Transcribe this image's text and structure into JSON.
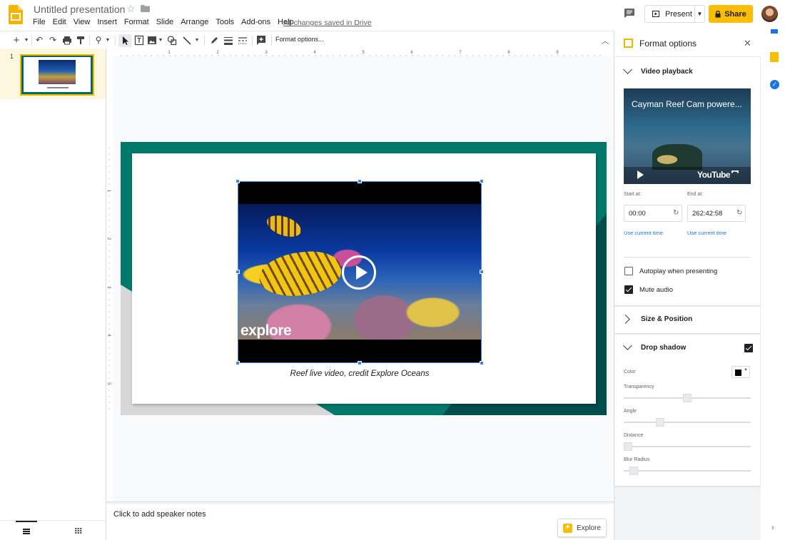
{
  "header": {
    "doc_title": "Untitled presentation",
    "menu": [
      "File",
      "Edit",
      "View",
      "Insert",
      "Format",
      "Slide",
      "Arrange",
      "Tools",
      "Add-ons",
      "Help"
    ],
    "save_status": "All changes saved in Drive",
    "present_label": "Present",
    "share_label": "Share"
  },
  "toolbar": {
    "format_options_label": "Format options..."
  },
  "filmstrip": {
    "slide_number": "1"
  },
  "slide": {
    "video_overlay_text": "explore",
    "caption": "Reef live video, credit Explore Oceans"
  },
  "notes": {
    "placeholder": "Click to add speaker notes",
    "explore_label": "Explore"
  },
  "panel": {
    "title": "Format options",
    "video_playback": {
      "label": "Video playback",
      "video_title": "Cayman Reef Cam powere...",
      "player_logo": "YouTube",
      "start_label": "Start at:",
      "start_value": "00:00",
      "end_label": "End at:",
      "end_value": "262:42:58",
      "use_current_start": "Use current time",
      "use_current_end": "Use current time",
      "autoplay_label": "Autoplay when presenting",
      "autoplay_checked": false,
      "mute_label": "Mute audio",
      "mute_checked": true
    },
    "size_position": {
      "label": "Size & Position"
    },
    "drop_shadow": {
      "label": "Drop shadow",
      "enabled": true,
      "color_label": "Color",
      "color_value": "#000000",
      "transparency_label": "Transparency",
      "transparency_value": 0.5,
      "angle_label": "Angle",
      "angle_value": 0.27,
      "distance_label": "Distance",
      "distance_value": 0.0,
      "blur_radius_label": "Blur Radius",
      "blur_radius_value": 0.05
    }
  },
  "colors": {
    "accent_yellow": "#fbbc04",
    "slide_teal": "#00796b",
    "selection_blue": "#4285f4",
    "link_blue": "#1a73e8"
  }
}
